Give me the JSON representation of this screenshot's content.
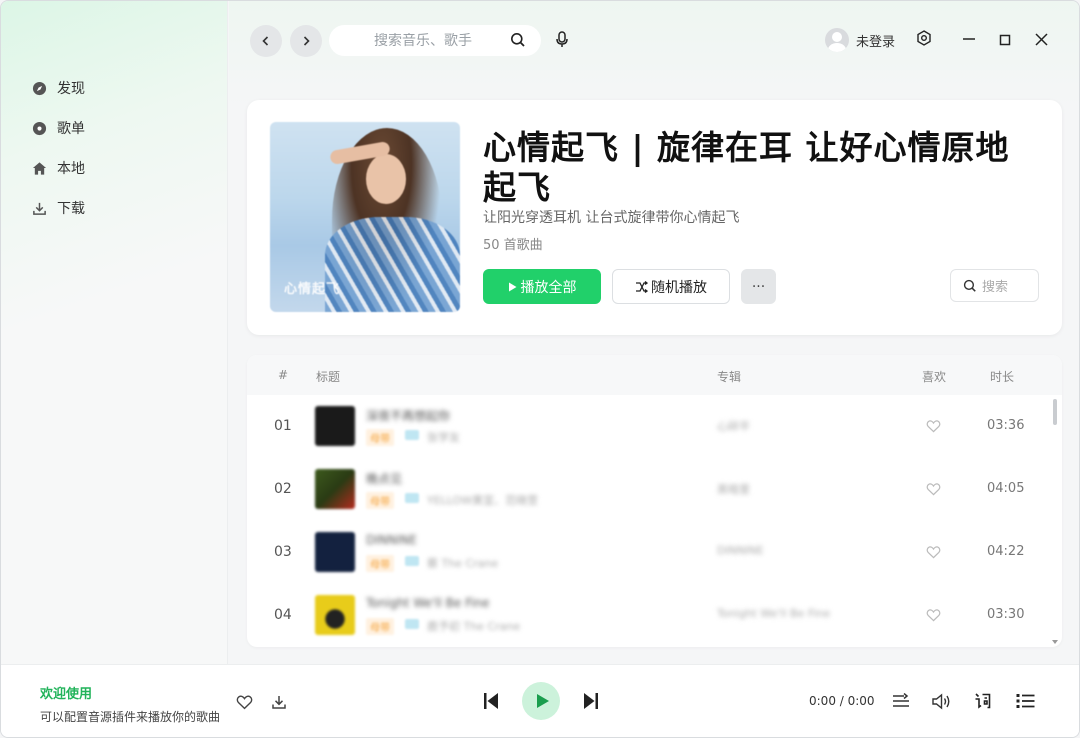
{
  "sidebar": {
    "items": [
      {
        "label": "发现",
        "icon": "compass-icon"
      },
      {
        "label": "歌单",
        "icon": "disc-icon"
      },
      {
        "label": "本地",
        "icon": "home-icon"
      },
      {
        "label": "下载",
        "icon": "download-icon"
      }
    ]
  },
  "topbar": {
    "search_placeholder": "搜索音乐、歌手",
    "user_label": "未登录"
  },
  "playlist": {
    "cover_caption": "心情起飞",
    "title": "心情起飞 | 旋律在耳 让好心情原地起飞",
    "description": "让阳光穿透耳机 让台式旋律带你心情起飞",
    "count": "50 首歌曲",
    "play_all_label": "播放全部",
    "shuffle_label": "随机播放",
    "more_label": "···",
    "search_label": "搜索"
  },
  "songlist": {
    "headers": {
      "index": "#",
      "title": "标题",
      "album": "专辑",
      "like": "喜欢",
      "duration": "时长"
    },
    "rows": [
      {
        "index": "01",
        "name": "深夜不再想起你",
        "tag": "母带",
        "artist": "张学友",
        "album": "心碎平",
        "duration": "03:36",
        "thumb": "#1a1a1a"
      },
      {
        "index": "02",
        "name": "晚点见",
        "tag": "母带",
        "artist": "YELLOW黄宣、范晓萱",
        "album": "黑暗里",
        "duration": "04:05",
        "thumb": "#3d5a1d"
      },
      {
        "index": "03",
        "name": "DINNINE",
        "tag": "母带",
        "artist": "蔡 The Crane",
        "album": "DINNINE",
        "duration": "04:22",
        "thumb": "#13213f"
      },
      {
        "index": "04",
        "name": "Tonight We'll Be Fine",
        "tag": "母带",
        "artist": "鹿予初 The Crane",
        "album": "Tonight We'll Be Fine",
        "duration": "03:30",
        "thumb": "#e8cc1a"
      }
    ]
  },
  "player": {
    "welcome": "欢迎使用",
    "hint": "可以配置音源插件来播放你的歌曲",
    "time": "0:00 / 0:00"
  },
  "colors": {
    "accent": "#21d06a",
    "accent_light": "#ccf2db",
    "welcome_green": "#21b35a"
  }
}
